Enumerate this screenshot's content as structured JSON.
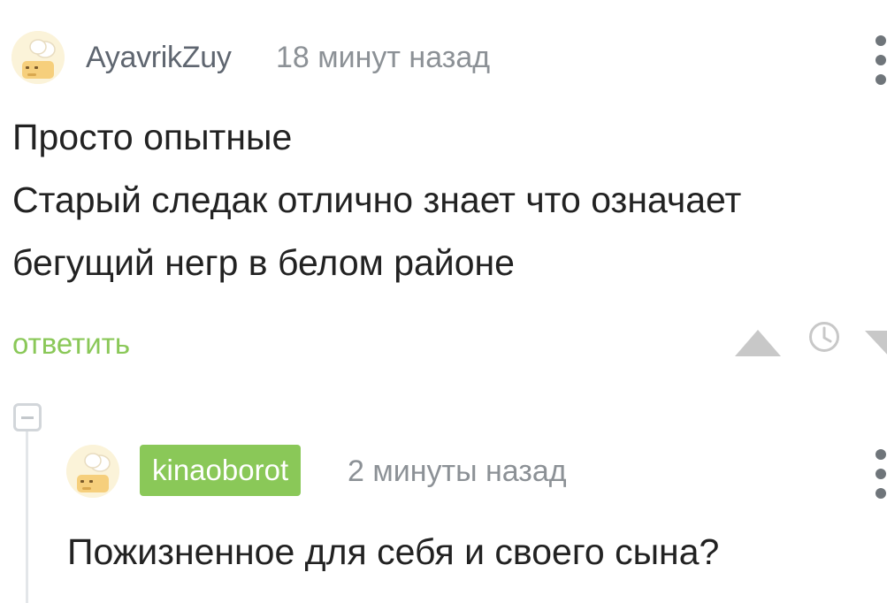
{
  "comment": {
    "username": "AyavrikZuy",
    "timestamp": "18 минут назад",
    "text_lines": [
      "Просто опытные",
      "Старый следак отлично знает что означает",
      "бегущий негр в белом районе"
    ],
    "reply_label": "ответить",
    "avatar_icon": "chef-hat-avatar-icon",
    "more_icon": "kebab-menu-icon",
    "upvote_icon": "triangle-up-icon",
    "save_icon": "clock-icon",
    "downvote_icon": "triangle-down-icon"
  },
  "reply": {
    "username": "kinaoborot",
    "timestamp": "2 минуты назад",
    "text": "Пожизненное для себя и своего сына?",
    "avatar_icon": "chef-hat-avatar-icon",
    "more_icon": "kebab-menu-icon"
  },
  "thread": {
    "collapse_icon": "minus-square-icon"
  },
  "colors": {
    "accent_green": "#8ac858",
    "text_dark": "#222222",
    "text_gray": "#8c9196",
    "username_gray": "#5f6670",
    "icon_gray": "#c8c8c8"
  }
}
